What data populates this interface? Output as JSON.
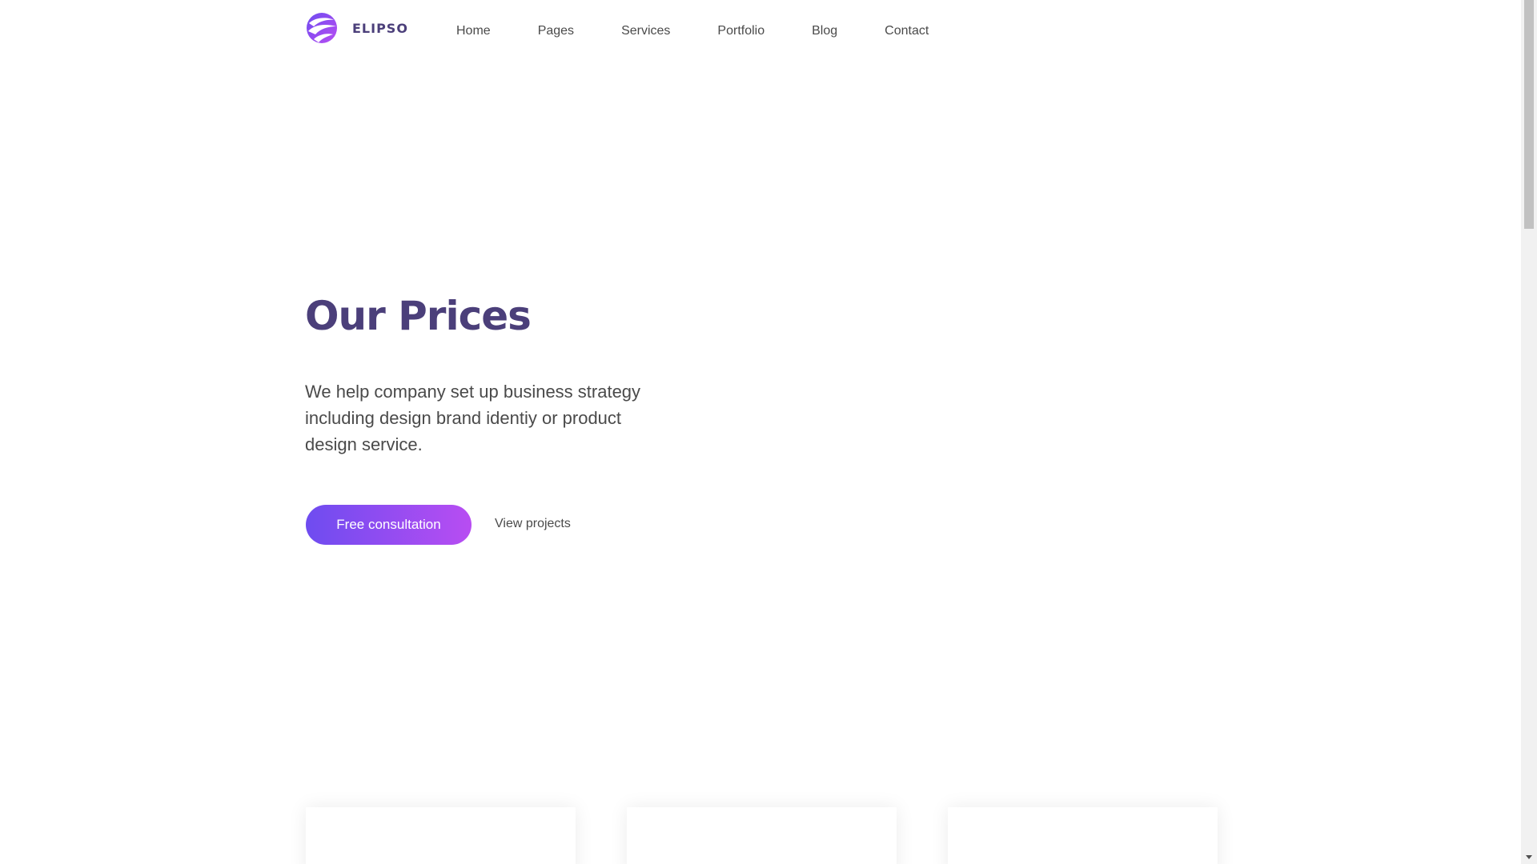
{
  "brand": {
    "name": "ELIPSO",
    "logo_icon": "swirl-globe-logo",
    "color_primary": "#4b3f7a",
    "gradient_start": "#6e4cf0",
    "gradient_end": "#b84df2"
  },
  "nav": {
    "items": [
      {
        "label": "Home"
      },
      {
        "label": "Pages"
      },
      {
        "label": "Services"
      },
      {
        "label": "Portfolio"
      },
      {
        "label": "Blog"
      },
      {
        "label": "Contact"
      }
    ]
  },
  "hero": {
    "title": "Our Prices",
    "description": "We help company set up business strategy including design brand identiy or product design service.",
    "cta_label": "Free consultation",
    "secondary_label": "View projects"
  },
  "pricing": {
    "cards": [
      {},
      {},
      {}
    ]
  },
  "scrollbar": {
    "down_icon": "triangle-down-icon"
  }
}
